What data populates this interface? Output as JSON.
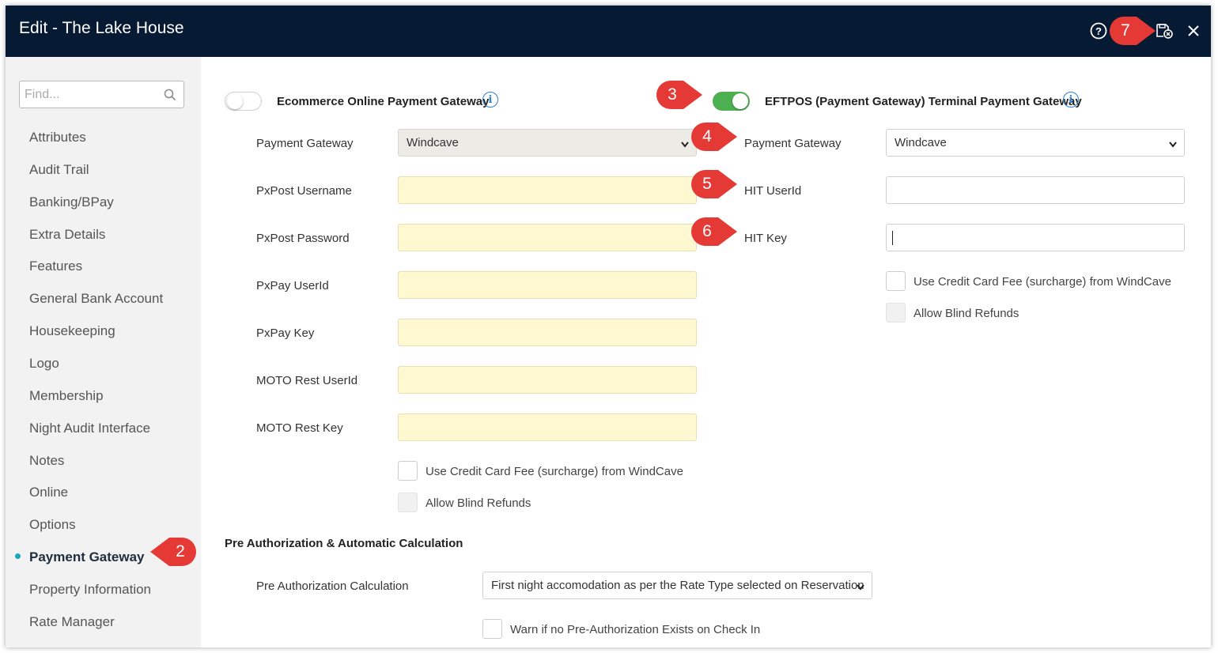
{
  "window": {
    "title": "Edit - The Lake House"
  },
  "titlebar": {
    "help_icon": "help-circle-icon",
    "save_icon": "save-close-icon",
    "close_icon": "close-icon"
  },
  "sidebar": {
    "search_placeholder": "Find...",
    "items": [
      {
        "label": "Attributes"
      },
      {
        "label": "Audit Trail"
      },
      {
        "label": "Banking/BPay"
      },
      {
        "label": "Extra Details"
      },
      {
        "label": "Features"
      },
      {
        "label": "General Bank Account"
      },
      {
        "label": "Housekeeping"
      },
      {
        "label": "Logo"
      },
      {
        "label": "Membership"
      },
      {
        "label": "Night Audit Interface"
      },
      {
        "label": "Notes"
      },
      {
        "label": "Online"
      },
      {
        "label": "Options"
      },
      {
        "label": "Payment Gateway",
        "active": true
      },
      {
        "label": "Property Information"
      },
      {
        "label": "Rate Manager"
      }
    ]
  },
  "ecommerce": {
    "heading": "Ecommerce Online Payment Gateway",
    "enabled": false,
    "payment_gateway_label": "Payment Gateway",
    "payment_gateway_value": "Windcave",
    "pxpost_username_label": "PxPost Username",
    "pxpost_password_label": "PxPost Password",
    "pxpay_userid_label": "PxPay UserId",
    "pxpay_key_label": "PxPay Key",
    "moto_rest_userid_label": "MOTO Rest UserId",
    "moto_rest_key_label": "MOTO Rest Key",
    "use_cc_fee_label": "Use Credit Card Fee (surcharge) from WindCave",
    "allow_blind_refunds_label": "Allow Blind Refunds"
  },
  "eftpos": {
    "heading": "EFTPOS (Payment Gateway) Terminal Payment Gateway",
    "enabled": true,
    "payment_gateway_label": "Payment Gateway",
    "payment_gateway_value": "Windcave",
    "hit_userid_label": "HIT UserId",
    "hit_key_label": "HIT Key",
    "use_cc_fee_label": "Use Credit Card Fee (surcharge) from WindCave",
    "allow_blind_refunds_label": "Allow Blind Refunds"
  },
  "preauth": {
    "heading": "Pre Authorization & Automatic Calculation",
    "calculation_label": "Pre Authorization Calculation",
    "calculation_value": "First night accomodation as per the Rate Type selected on Reservation",
    "warn_label": "Warn if no Pre-Authorization Exists on Check In"
  },
  "callouts": {
    "c2": "2",
    "c3": "3",
    "c4": "4",
    "c5": "5",
    "c6": "6",
    "c7": "7"
  },
  "colors": {
    "titlebar": "#061a33",
    "toggle_on": "#4caf50",
    "field_yellow": "#fff8d1",
    "callout": "#e53935",
    "active_dot": "#1aa7b8",
    "info": "#2d7fd3"
  }
}
